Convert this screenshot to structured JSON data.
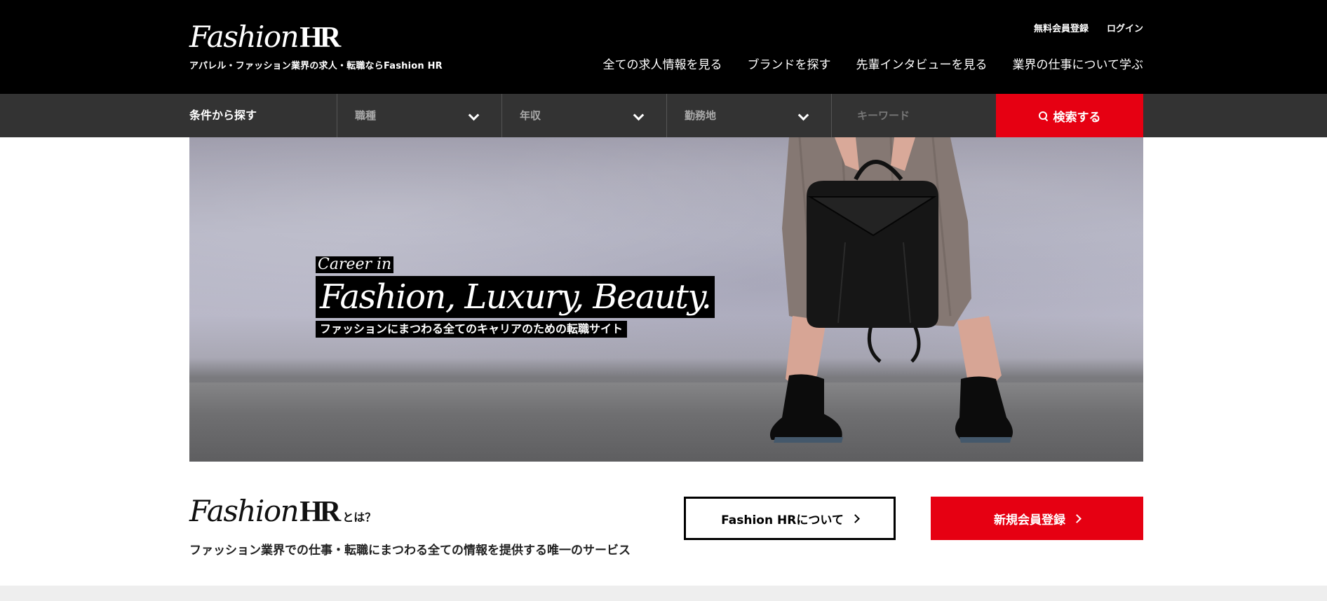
{
  "header": {
    "logo_text": "Fashion",
    "logo_hr": "HR",
    "tagline": "アパレル・ファッション業界の求人・転職ならFashion HR",
    "util_links": [
      "無料会員登録",
      "ログイン"
    ],
    "nav": [
      "全ての求人情報を見る",
      "ブランドを探す",
      "先輩インタビューを見る",
      "業界の仕事について学ぶ"
    ]
  },
  "search": {
    "title": "条件から探す",
    "job_type": "職種",
    "salary": "年収",
    "location": "勤務地",
    "keyword_placeholder": "キーワード",
    "submit_label": "検索する"
  },
  "hero": {
    "line1": "Career in",
    "line2": "Fashion, Luxury, Beauty.",
    "line3": "ファッションにまつわる全てのキャリアのための転職サイト"
  },
  "about": {
    "logo_text": "Fashion",
    "logo_hr": "HR",
    "toha": "とは？",
    "description": "ファッション業界での仕事・転職にまつわる全ての情報を提供する唯一のサービス",
    "about_button": "Fashion HRについて",
    "register_button": "新規会員登録"
  },
  "colors": {
    "accent": "#e60012",
    "header_bg": "#000000",
    "searchbar_bg": "#333333"
  }
}
